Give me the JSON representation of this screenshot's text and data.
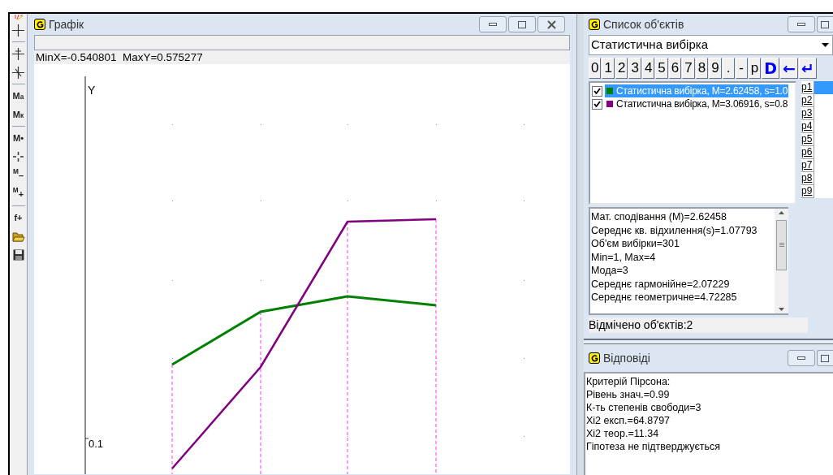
{
  "toolbar": [
    {
      "kind": "partial"
    },
    {
      "kind": "cross"
    },
    {
      "kind": "cross-tick"
    },
    {
      "kind": "cross-slant"
    },
    {
      "kind": "label",
      "label": "M$_{a}$"
    },
    {
      "kind": "label",
      "label": "M$_{к}$"
    },
    {
      "kind": "label",
      "label": "M•"
    },
    {
      "kind": "scale"
    },
    {
      "kind": "label",
      "label": "$^{M}$–"
    },
    {
      "kind": "label",
      "label": "$^{M}$+"
    },
    {
      "kind": "label",
      "label": "f+"
    },
    {
      "kind": "folder"
    },
    {
      "kind": "floppy"
    }
  ],
  "graph_window": {
    "title": "Графік",
    "coords": "MinX=-0.540801  MaxY=0.575277",
    "axis_label": "Y",
    "tick_label": "0.1"
  },
  "objects_window": {
    "title": "Список об'єктів",
    "combo": "Статистична вибірка",
    "keys": [
      {
        "label": "0"
      },
      {
        "label": "1"
      },
      {
        "label": "2"
      },
      {
        "label": "3"
      },
      {
        "label": "4"
      },
      {
        "label": "5"
      },
      {
        "label": "6"
      },
      {
        "label": "7"
      },
      {
        "label": "8"
      },
      {
        "label": "9"
      },
      {
        "label": "."
      },
      {
        "label": "-"
      },
      {
        "label": "p"
      },
      {
        "label": "D",
        "color": "#0000ff"
      },
      {
        "label": "←",
        "color": "#0000ff"
      },
      {
        "label": "↵",
        "color": "#0000ff"
      }
    ],
    "items": [
      {
        "label": "Статистична вибірка, M=2.62458, s=1.0",
        "checked": true,
        "color": "#008000",
        "selected": true
      },
      {
        "label": "Статистична вибірка, M=3.06916, s=0.8",
        "checked": true,
        "color": "#800080",
        "selected": false
      }
    ],
    "params": [
      {
        "label": "p1",
        "selected": true
      },
      {
        "label": "p2",
        "selected": false
      },
      {
        "label": "p3",
        "selected": false
      },
      {
        "label": "p4",
        "selected": false
      },
      {
        "label": "p5",
        "selected": false
      },
      {
        "label": "p6",
        "selected": false
      },
      {
        "label": "p7",
        "selected": false
      },
      {
        "label": "p8",
        "selected": false
      },
      {
        "label": "p9",
        "selected": false
      }
    ],
    "stats": [
      "Мат. сподівання (M)=2.62458",
      "Середнє кв. відхилення(s)=1.07793",
      "Об'єм вибірки=301",
      "Min=1, Max=4",
      "Мода=3",
      "Середнє гармонійне=2.07229",
      "Середнє геометричне=4.72285"
    ],
    "status": "Відмічено об'єктів:2"
  },
  "answers_window": {
    "title": "Відповіді",
    "lines": [
      "Критерій Пірсона:",
      "Рівень знач.=0.99",
      "К-ть степенів свободи=3",
      "Xi2 експ.=64.8797",
      "Xi2 теор.=11.34",
      "Гіпотеза не підтверджується"
    ]
  }
}
